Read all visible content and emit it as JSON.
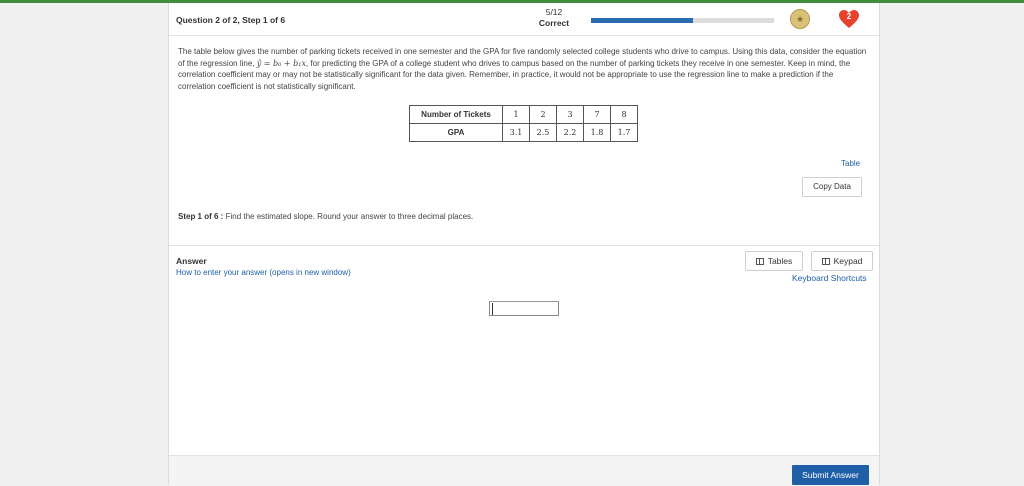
{
  "header": {
    "question_label": "Question 2 of 2, Step 1 of 6",
    "score": "5/12",
    "score_status": "Correct",
    "progress_fraction": 0.56,
    "lives": "2",
    "colors": {
      "accent": "#1f5fa8",
      "progress": "#2a6bb0",
      "heart": "#e8412c",
      "top_bar": "#3f8f3a"
    }
  },
  "problem": {
    "intro": "The table below gives the number of parking tickets received in one semester and the GPA for five randomly selected college students who drive to campus. Using this data, consider the equation of the regression line, ",
    "equation": "ŷ = b₀ + b₁x",
    "rest": ", for predicting the GPA of a college student who drives to campus based on the number of parking tickets they receive in one semester. Keep in mind, the correlation coefficient may or may not be statistically significant for the data given. Remember, in practice, it would not be appropriate to use the regression line to make a prediction if the correlation coefficient is not statistically significant."
  },
  "data_table": {
    "row1_label": "Number of Tickets",
    "row1_values": [
      "1",
      "2",
      "3",
      "7",
      "8"
    ],
    "row2_label": "GPA",
    "row2_values": [
      "3.1",
      "2.5",
      "2.2",
      "1.8",
      "1.7"
    ]
  },
  "table_link": "Table",
  "copy_data_button": "Copy Data",
  "step": {
    "label": "Step 1 of 6 :",
    "instruction": "Find the estimated slope. Round your answer to three decimal places."
  },
  "answer": {
    "label": "Answer",
    "howto_link": "How to enter your answer (opens in new window)",
    "value": ""
  },
  "tools": {
    "tables_button": "Tables",
    "keypad_button": "Keypad",
    "shortcuts_link": "Keyboard Shortcuts"
  },
  "footer": {
    "submit_button": "Submit Answer"
  },
  "icons": [
    "coin-badge-icon",
    "heart-icon",
    "table-icon",
    "keypad-icon"
  ]
}
